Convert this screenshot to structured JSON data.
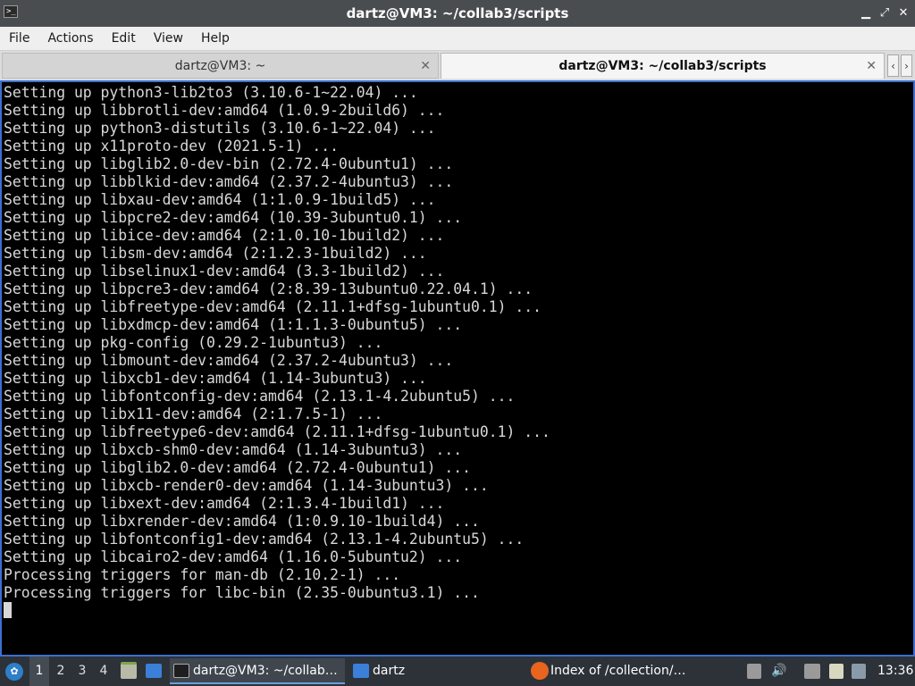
{
  "window": {
    "title": "dartz@VM3: ~/collab3/scripts",
    "controls": {
      "minimize": "▁",
      "maximize": "⤢",
      "close": "✕"
    }
  },
  "menu": [
    "File",
    "Actions",
    "Edit",
    "View",
    "Help"
  ],
  "tabs": [
    {
      "label": "dartz@VM3: ~",
      "active": false
    },
    {
      "label": "dartz@VM3: ~/collab3/scripts",
      "active": true
    }
  ],
  "tab_scroll": {
    "left": "‹",
    "right": "›"
  },
  "terminal": {
    "lines": [
      "Setting up python3-lib2to3 (3.10.6-1~22.04) ...",
      "Setting up libbrotli-dev:amd64 (1.0.9-2build6) ...",
      "Setting up python3-distutils (3.10.6-1~22.04) ...",
      "Setting up x11proto-dev (2021.5-1) ...",
      "Setting up libglib2.0-dev-bin (2.72.4-0ubuntu1) ...",
      "Setting up libblkid-dev:amd64 (2.37.2-4ubuntu3) ...",
      "Setting up libxau-dev:amd64 (1:1.0.9-1build5) ...",
      "Setting up libpcre2-dev:amd64 (10.39-3ubuntu0.1) ...",
      "Setting up libice-dev:amd64 (2:1.0.10-1build2) ...",
      "Setting up libsm-dev:amd64 (2:1.2.3-1build2) ...",
      "Setting up libselinux1-dev:amd64 (3.3-1build2) ...",
      "Setting up libpcre3-dev:amd64 (2:8.39-13ubuntu0.22.04.1) ...",
      "Setting up libfreetype-dev:amd64 (2.11.1+dfsg-1ubuntu0.1) ...",
      "Setting up libxdmcp-dev:amd64 (1:1.1.3-0ubuntu5) ...",
      "Setting up pkg-config (0.29.2-1ubuntu3) ...",
      "Setting up libmount-dev:amd64 (2.37.2-4ubuntu3) ...",
      "Setting up libxcb1-dev:amd64 (1.14-3ubuntu3) ...",
      "Setting up libfontconfig-dev:amd64 (2.13.1-4.2ubuntu5) ...",
      "Setting up libx11-dev:amd64 (2:1.7.5-1) ...",
      "Setting up libfreetype6-dev:amd64 (2.11.1+dfsg-1ubuntu0.1) ...",
      "Setting up libxcb-shm0-dev:amd64 (1.14-3ubuntu3) ...",
      "Setting up libglib2.0-dev:amd64 (2.72.4-0ubuntu1) ...",
      "Setting up libxcb-render0-dev:amd64 (1.14-3ubuntu3) ...",
      "Setting up libxext-dev:amd64 (2:1.3.4-1build1) ...",
      "Setting up libxrender-dev:amd64 (1:0.9.10-1build4) ...",
      "Setting up libfontconfig1-dev:amd64 (2.13.1-4.2ubuntu5) ...",
      "Setting up libcairo2-dev:amd64 (1.16.0-5ubuntu2) ...",
      "Processing triggers for man-db (2.10.2-1) ...",
      "Processing triggers for libc-bin (2.35-0ubuntu3.1) ..."
    ]
  },
  "taskbar": {
    "workspaces": [
      "1",
      "2",
      "3",
      "4"
    ],
    "active_workspace": "1",
    "tasks": [
      {
        "label": "dartz@VM3: ~/collab…",
        "icon": "terminal-icon",
        "active": true
      },
      {
        "label": "dartz",
        "icon": "folder-icon",
        "active": false
      },
      {
        "label": "Index of /collection/…",
        "icon": "firefox-icon",
        "active": false
      }
    ],
    "clock": "13:36"
  },
  "colors": {
    "titlebar": "#4a4d50",
    "terminal_bg": "#000000",
    "terminal_fg": "#d8d8d8",
    "terminal_border": "#3d6fd0",
    "taskbar": "#2c3238"
  }
}
